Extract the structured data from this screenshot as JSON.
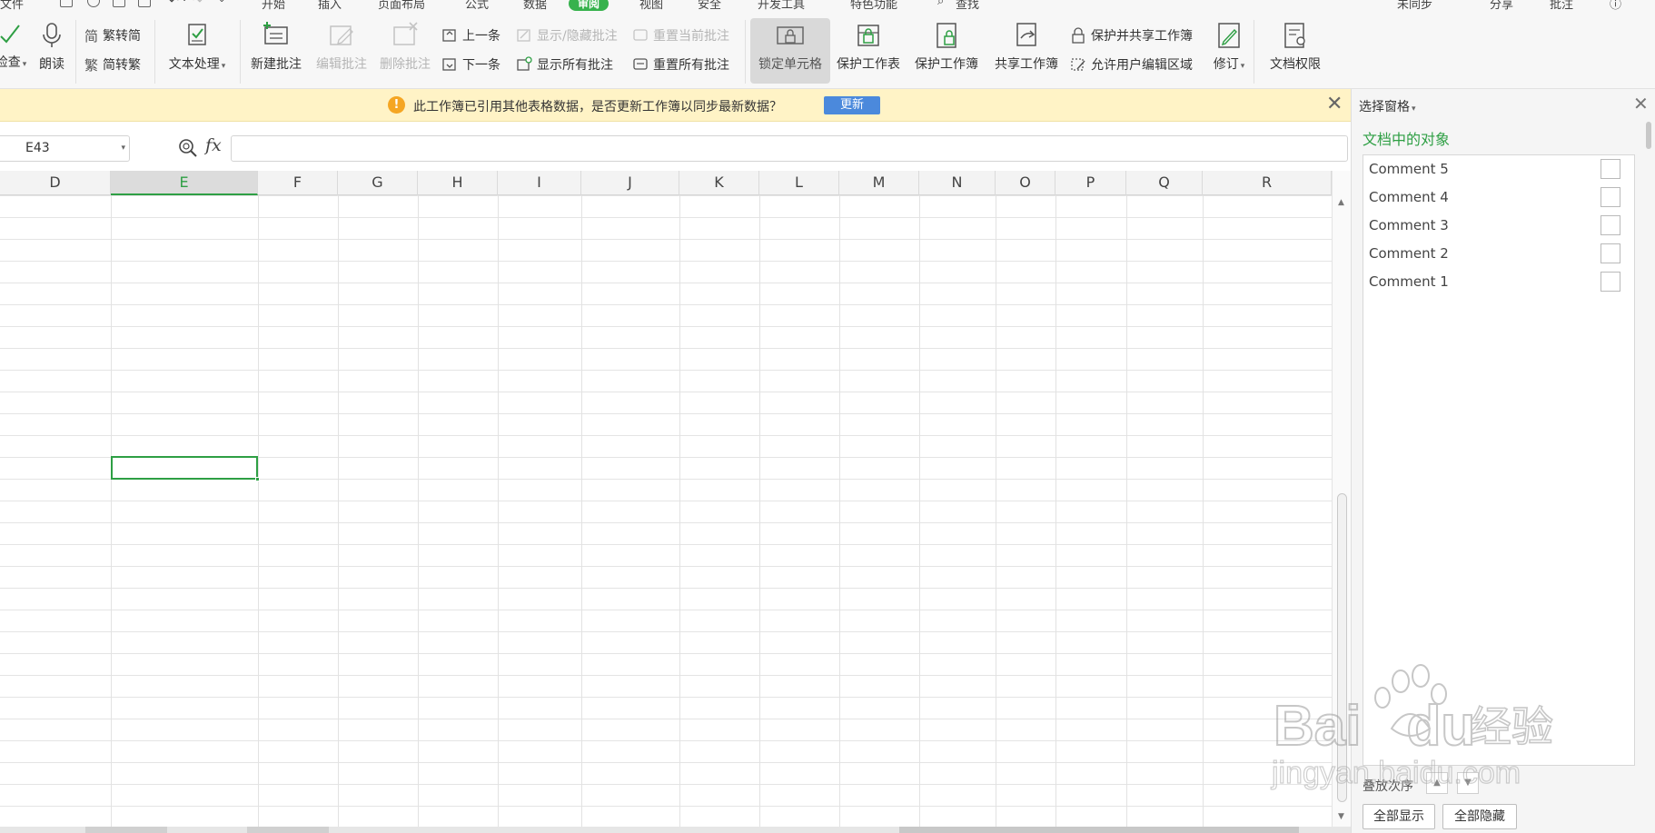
{
  "menubar": {
    "items": [
      {
        "label": "开始",
        "active": false
      },
      {
        "label": "插入",
        "active": false
      },
      {
        "label": "页面布局",
        "active": false
      },
      {
        "label": "公式",
        "active": false
      },
      {
        "label": "数据",
        "active": false
      },
      {
        "label": "审阅",
        "active": true
      },
      {
        "label": "视图",
        "active": false
      },
      {
        "label": "安全",
        "active": false
      },
      {
        "label": "开发工具",
        "active": false
      },
      {
        "label": "特色功能",
        "active": false
      },
      {
        "label": "查找",
        "active": false
      }
    ],
    "file_label": "文件",
    "right_items": [
      "未同步",
      "分享",
      "批注"
    ]
  },
  "ribbon": {
    "check_label": "检查",
    "read_aloud": "朗读",
    "to_traditional": "繁转简",
    "to_simplified": "简转繁",
    "text_processing": "文本处理",
    "new_comment": "新建批注",
    "edit_comment": "编辑批注",
    "delete_comment": "删除批注",
    "prev_item": "上一条",
    "next_item": "下一条",
    "show_hide_comment": "显示/隐藏批注",
    "show_all_comments": "显示所有批注",
    "reset_current_comment": "重置当前批注",
    "reset_all_comments": "重置所有批注",
    "lock_cell": "锁定单元格",
    "protect_sheet": "保护工作表",
    "protect_workbook": "保护工作簿",
    "share_workbook": "共享工作簿",
    "protect_and_share": "保护并共享工作簿",
    "allow_edit_ranges": "允许用户编辑区域",
    "revise": "修订",
    "doc_permissions": "文档权限"
  },
  "notice": {
    "icon": "!",
    "message": "此工作簿已引用其他表格数据，是否更新工作簿以同步最新数据？",
    "update_label": "更新"
  },
  "formula_bar": {
    "name_box": "E43",
    "fx": "fx",
    "formula": ""
  },
  "sheet": {
    "columns": [
      "D",
      "E",
      "F",
      "G",
      "H",
      "I",
      "J",
      "K",
      "L",
      "M",
      "N",
      "O",
      "P",
      "Q",
      "R"
    ],
    "selected_column": "E"
  },
  "selection_pane": {
    "title": "选择窗格",
    "subtitle": "文档中的对象",
    "objects": [
      "Comment 5",
      "Comment 4",
      "Comment 3",
      "Comment 2",
      "Comment 1"
    ],
    "order_label": "叠放次序",
    "show_all": "全部显示",
    "hide_all": "全部隐藏"
  },
  "watermark": {
    "brand": "Bai",
    "brand2": "du",
    "cn": "经验",
    "url": "jingyan.baidu.com"
  },
  "colors": {
    "accent_green": "#2e9f44",
    "notice_bg": "#fff3c6",
    "update_blue": "#4b89dc"
  }
}
